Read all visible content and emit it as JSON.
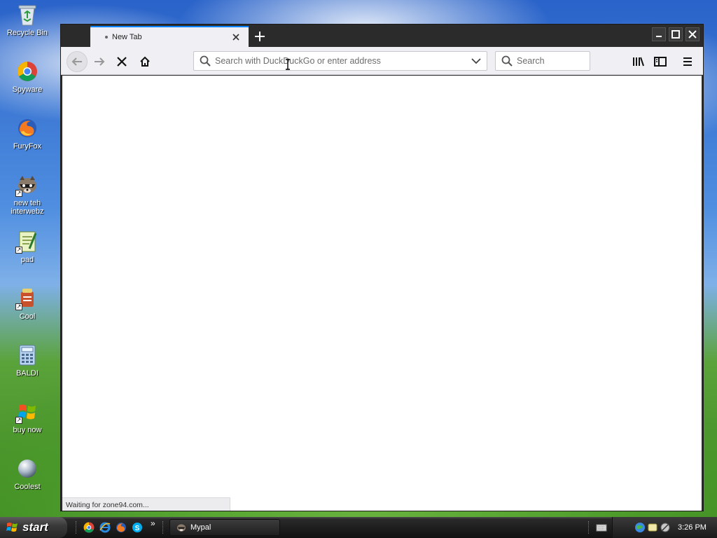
{
  "desktop": {
    "icons": [
      {
        "label": "Recycle Bin",
        "icon": "recycle-bin-icon",
        "shortcut": false
      },
      {
        "label": "Spyware",
        "icon": "chrome-icon",
        "shortcut": false
      },
      {
        "label": "FuryFox",
        "icon": "firefox-icon",
        "shortcut": false
      },
      {
        "label": "new teh interwebz",
        "icon": "raccoon-icon",
        "shortcut": true
      },
      {
        "label": "pad",
        "icon": "notepad-icon",
        "shortcut": true
      },
      {
        "label": "Cool",
        "icon": "cool-icon",
        "shortcut": true
      },
      {
        "label": "BALDI",
        "icon": "calculator-icon",
        "shortcut": false
      },
      {
        "label": "buy now",
        "icon": "windows-logo-icon",
        "shortcut": true
      },
      {
        "label": "Coolest",
        "icon": "orb-icon",
        "shortcut": false
      }
    ]
  },
  "browser": {
    "tab": {
      "title": "New Tab",
      "loading": true
    },
    "address_bar": {
      "placeholder": "Search with DuckDuckGo or enter address",
      "value": ""
    },
    "search_bar": {
      "placeholder": "Search"
    },
    "status_text": "Waiting for zone94.com...",
    "accent_color": "#0a84ff"
  },
  "taskbar": {
    "start_label": "start",
    "quick_launch": [
      "chrome-icon",
      "ie-icon",
      "firefox-icon",
      "skype-icon"
    ],
    "overflow_label": "»",
    "task_button_label": "Mypal",
    "clock": "3:26 PM"
  }
}
